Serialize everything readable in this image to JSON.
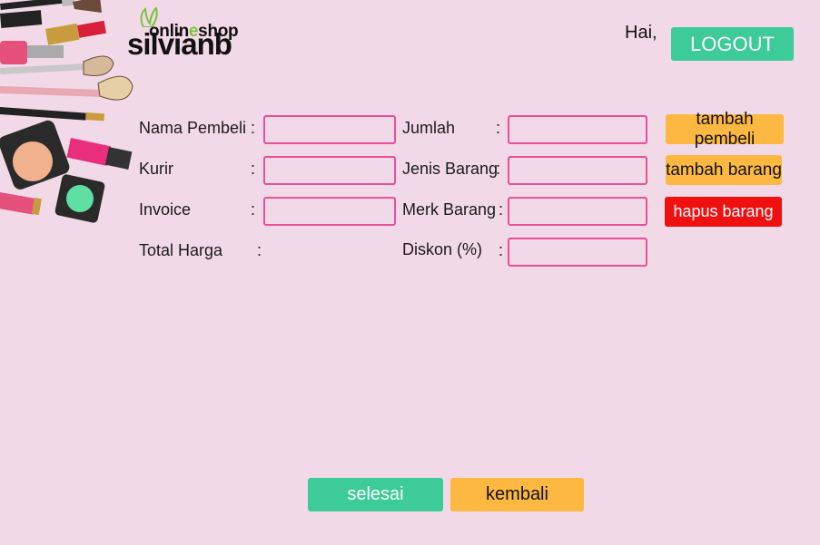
{
  "brand": {
    "online_part1": "onlin",
    "online_accent": "e",
    "online_part2": "shop",
    "name": "silvianb"
  },
  "header": {
    "greeting": "Hai,",
    "logout_label": "LOGOUT"
  },
  "form": {
    "left": [
      {
        "label": "Nama Pembeli",
        "colon": ":",
        "value": "",
        "has_input": true
      },
      {
        "label": "Kurir",
        "colon": ":",
        "value": "",
        "has_input": true
      },
      {
        "label": "Invoice",
        "colon": ":",
        "value": "",
        "has_input": true
      },
      {
        "label": "Total Harga",
        "colon": ":",
        "value": "",
        "has_input": false
      }
    ],
    "right": [
      {
        "label": "Jumlah",
        "colon": ":",
        "value": ""
      },
      {
        "label": "Jenis Barang",
        "colon": ":",
        "value": ""
      },
      {
        "label": "Merk Barang",
        "colon": ":",
        "value": ""
      },
      {
        "label": "Diskon (%)",
        "colon": ":",
        "value": ""
      }
    ]
  },
  "actions": {
    "tambah_pembeli": "tambah pembeli",
    "tambah_barang": "tambah barang",
    "hapus_barang": "hapus barang",
    "selesai": "selesai",
    "kembali": "kembali"
  },
  "colors": {
    "background": "#f2d9e7",
    "field_border": "#ea4f9a",
    "green_button": "#3ccb99",
    "orange_button": "#fdb841",
    "red_button": "#f01010",
    "logo_accent": "#7ac43a"
  },
  "decor_icons": [
    "makeup-brush-icon",
    "lipstick-icon",
    "eyeliner-icon",
    "compact-powder-icon",
    "eyeshadow-icon",
    "nail-polish-icon"
  ]
}
